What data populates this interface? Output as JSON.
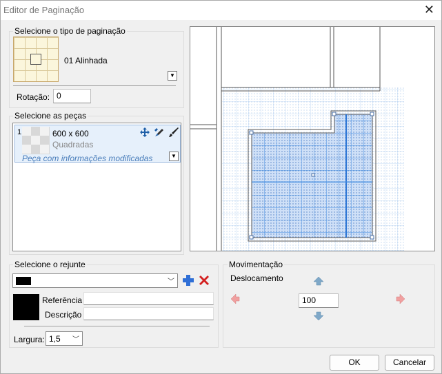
{
  "window": {
    "title": "Editor de Paginação",
    "close_icon": "close-icon"
  },
  "paging_type": {
    "legend": "Selecione o tipo de paginação",
    "selected_name": "01 Alinhada",
    "rotation_label": "Rotação:",
    "rotation_value": "0"
  },
  "pieces": {
    "legend": "Selecione as peças",
    "items": [
      {
        "index": "1",
        "size": "600 x 600",
        "name": "Quadradas",
        "note": "Peça com informações modificadas"
      }
    ],
    "accent_note_color": "#4a7ebb"
  },
  "grout": {
    "legend": "Selecione o rejunte",
    "color": "#000000",
    "reference_label": "Referência",
    "reference_value": "",
    "description_label": "Descrição",
    "description_value": "",
    "width_label": "Largura:",
    "width_value": "1,5"
  },
  "movement": {
    "legend": "Movimentação",
    "offset_label": "Deslocamento",
    "offset_value": "100"
  },
  "buttons": {
    "ok": "OK",
    "cancel": "Cancelar"
  },
  "colors": {
    "selection": "#e6f0fb",
    "grid_line": "#4a90e2",
    "add_icon": "#2f6fd6",
    "remove_icon": "#d32020"
  }
}
